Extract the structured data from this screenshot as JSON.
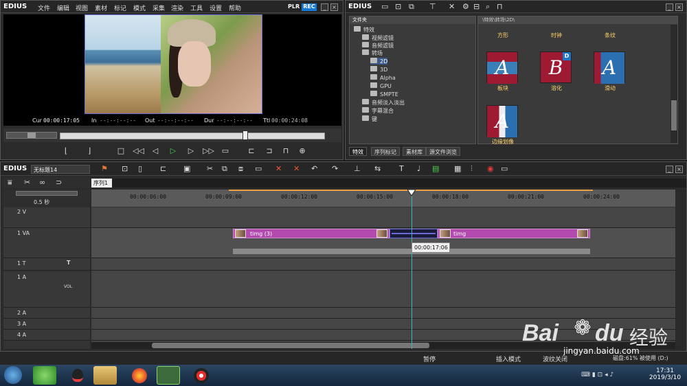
{
  "app": {
    "name": "EDIUS"
  },
  "menu": [
    "文件",
    "编辑",
    "视图",
    "素材",
    "标记",
    "模式",
    "采集",
    "渲染",
    "工具",
    "设置",
    "帮助"
  ],
  "player": {
    "plr": "PLR",
    "rec": "REC"
  },
  "timecode": {
    "cur_label": "Cur",
    "cur_value": "00:00:17:05",
    "in_label": "In",
    "in_value": "--:--:--:--",
    "out_label": "Out",
    "out_value": "--:--:--:--",
    "dur_label": "Dur",
    "dur_value": "--:--:--:--",
    "ttl_label": "Ttl",
    "ttl_value": "00:00:24:08"
  },
  "effects": {
    "title": "EDIUS",
    "tree_header": "文件夹",
    "tree": [
      {
        "label": "特效",
        "indent": 0
      },
      {
        "label": "视频滤镜",
        "indent": 1
      },
      {
        "label": "音频滤镜",
        "indent": 1
      },
      {
        "label": "转场",
        "indent": 1
      },
      {
        "label": "2D",
        "indent": 2,
        "selected": true
      },
      {
        "label": "3D",
        "indent": 2
      },
      {
        "label": "Alpha",
        "indent": 2
      },
      {
        "label": "GPU",
        "indent": 2
      },
      {
        "label": "SMPTE",
        "indent": 2
      },
      {
        "label": "音频淡入淡出",
        "indent": 1
      },
      {
        "label": "字幕混合",
        "indent": 1
      },
      {
        "label": "键",
        "indent": 1
      }
    ],
    "path": "\\特效\\转场\\2D\\",
    "top_labels": [
      "方形",
      "时钟",
      "条纹"
    ],
    "thumbs": [
      {
        "letter": "A",
        "label": "板块"
      },
      {
        "letter": "B",
        "label": "溶化"
      },
      {
        "letter": "A",
        "label": "滑动"
      },
      {
        "letter": "A",
        "label": "边缘划像"
      }
    ],
    "tabs": [
      "特效",
      "序列标记",
      "素材库",
      "源文件浏览"
    ]
  },
  "timeline": {
    "title": "EDIUS",
    "project": "无标题14",
    "sequence_tab": "序列1",
    "zoom": "0.5 秒",
    "ruler": [
      "00:00:06:00",
      "00:00:09:00",
      "00:00:12:00",
      "00:00:15:00",
      "00:00:18:00",
      "00:00:21:00",
      "00:00:24:00"
    ],
    "tracks": [
      "2 V",
      "1 VA",
      "1 T",
      "1 A",
      "2 A",
      "3 A",
      "4 A"
    ],
    "vol_label": "VOL",
    "clip1": "timg (3)",
    "clip2": "timg",
    "tooltip": "00:00:17:06"
  },
  "status": {
    "pause": "暂停",
    "insert_mode": "插入模式",
    "ripple": "波纹关闭",
    "disk": "磁盘:61% 被使用 (D:)"
  },
  "taskbar": {
    "time": "17:31",
    "date": "2019/3/10"
  },
  "watermark": {
    "brand": "Bai",
    "brand2": "du",
    "cn": "经验",
    "url": "jingyan.baidu.com"
  }
}
